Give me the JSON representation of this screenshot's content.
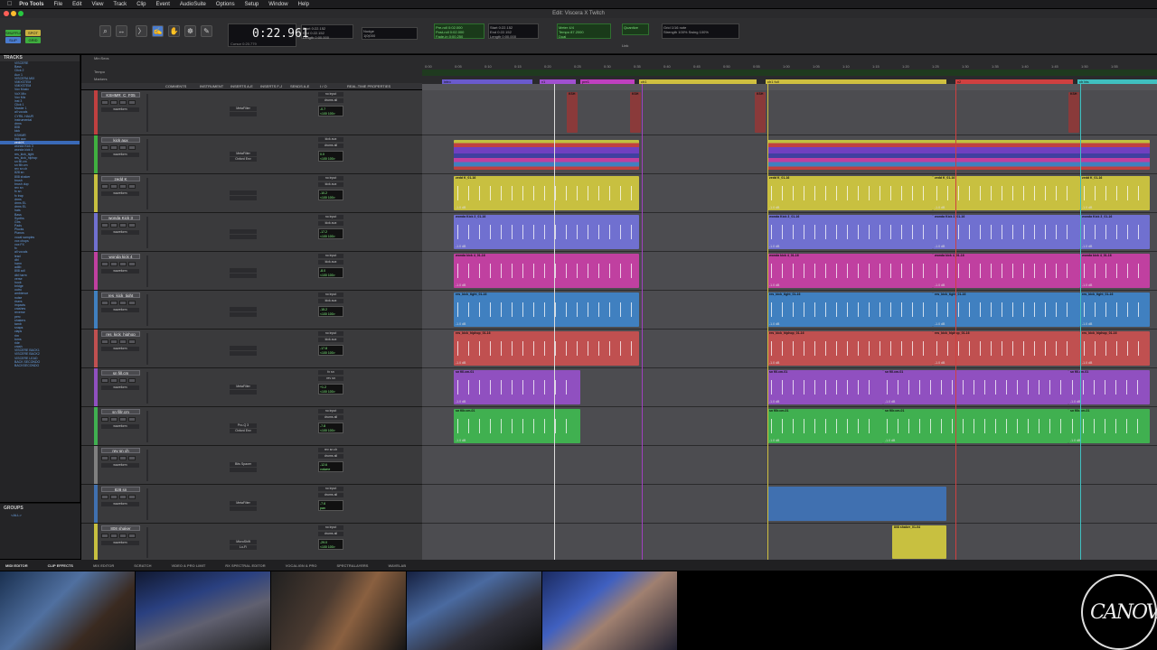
{
  "menubar": {
    "app": "Pro Tools",
    "items": [
      "File",
      "Edit",
      "View",
      "Track",
      "Clip",
      "Event",
      "AudioSuite",
      "Options",
      "Setup",
      "Window",
      "Help"
    ]
  },
  "window": {
    "title": "Edit: Viscera X Twitch"
  },
  "toolbar": {
    "modes": [
      "SHUFFLE",
      "SPOT",
      "SLIP",
      "GRID"
    ],
    "counter_main": "0:22.961",
    "cursor_label": "Cursor",
    "cursor_value": "0:20.779",
    "start_label": "Start",
    "start_value": "0:22.152",
    "end_label": "End",
    "end_value": "0:22.152",
    "length_label": "Length",
    "length_value": "0:00.000",
    "nudge_label": "Nudge",
    "nudge_value": "1|0|000",
    "preroll_label": "Pre-roll",
    "preroll_value": "0:02.000",
    "postroll_label": "Post-roll",
    "postroll_value": "0:02.000",
    "fadein_label": "Fade-in",
    "fadein_value": "0:00.250",
    "start2_value": "0:22.152",
    "end2_value": "0:22.152",
    "length2_value": "0:00.000",
    "meter_label": "Meter",
    "meter_value": "4/4",
    "tempo_label": "Tempo",
    "tempo_value": "87.2000",
    "dual_label": "Dual",
    "grid_label": "Grid",
    "grid_value": "1/16 note",
    "quantize_label": "Quantize",
    "strength_label": "Strength",
    "strength_value": "100%",
    "swing_label": "Swing",
    "swing_value": "100%",
    "link_label": "Link"
  },
  "tracks_panel": {
    "header": "TRACKS",
    "items": [
      "VISCERE",
      "Bass",
      "Click 2",
      "Aux 1",
      "VISCERA MIX",
      "VMIXSTEM",
      "VMIXSTEM",
      "Vox Music",
      "VoX Mix",
      "Vox Mix",
      "inst 3",
      "Click 1",
      "Master 1",
      "all vocals",
      "CYRIL HAUR",
      "instrumental",
      "drms",
      "808",
      "kick",
      "KSHMR",
      "kick aux",
      "zedd K",
      "wonda Kick 3",
      "wonda kick 4",
      "res_kick_tight",
      "res_kick_hiphop",
      "sn fill.cm",
      "sn fillr.cm",
      "rev sn ch",
      "828 sn",
      "808 shaker",
      "brush",
      "brush dup",
      "rev sn",
      "fx sn",
      "fx trap",
      "drms",
      "drms EL",
      "drms EL",
      "hats",
      "Bass",
      "Synths",
      "Gtrs",
      "Pads",
      "Plucks",
      "Pianos",
      "vocal samples",
      "vox chops",
      "vox FX",
      "fx",
      "all vocals",
      "lead",
      "dbl",
      "harm",
      "adlib",
      "808 adl",
      "dbl harm",
      "verse",
      "hook",
      "bridge",
      "outro",
      "ambience",
      "noise",
      "risers",
      "impacts",
      "crashes",
      "reverse",
      "perc",
      "shakers",
      "tamb",
      "snaps",
      "claps",
      "rim",
      "toms",
      "ride",
      "crash",
      "VISCERE BACK1",
      "VISCERE BACK2",
      "VISCERE LEAD",
      "BACK SECONDO",
      "BACKSECONDO"
    ],
    "selected_index": 21
  },
  "groups_panel": {
    "header": "GROUPS",
    "items": [
      "<ALL>"
    ]
  },
  "rulers": {
    "labels": [
      "Min:Secs",
      "Tempo",
      "Markers"
    ],
    "ticks": [
      "0:00",
      "0:05",
      "0:10",
      "0:15",
      "0:20",
      "0:25",
      "0:30",
      "0:35",
      "0:40",
      "0:45",
      "0:50",
      "0:55",
      "1:00",
      "1:05",
      "1:10",
      "1:15",
      "1:20",
      "1:25",
      "1:30",
      "1:35",
      "1:40",
      "1:45",
      "1:50",
      "1:55"
    ]
  },
  "column_headers": [
    "COMMENTS",
    "INSTRUMENT",
    "INSERTS A-E",
    "INSERTS F-J",
    "SENDS A-E",
    "I / O",
    "REAL-TIME PROPERTIES"
  ],
  "markers": [
    {
      "label": "intro",
      "color": "#6a5acd"
    },
    {
      "label": "v1",
      "color": "#a050d0"
    },
    {
      "label": "pre1",
      "color": "#c040c0"
    },
    {
      "label": "ch1",
      "color": "#d0c040"
    },
    {
      "label": "ch1 full",
      "color": "#d0c040"
    },
    {
      "label": "v2",
      "color": "#d04040"
    },
    {
      "label": "ch bis",
      "color": "#40c0c0"
    }
  ],
  "tracks": [
    {
      "name": "KSHMR_C_F05",
      "color": "#c04040",
      "insert": "MetaFilter",
      "io_in": "no input",
      "io_out": "drums all",
      "vol": "-0.7",
      "pan": "<100 100>",
      "clip": "KSH"
    },
    {
      "name": "kick aux",
      "color": "#40b040",
      "insert": "MetaFilter",
      "insert2": "Oxford Env",
      "io_in": "kick aux",
      "io_out": "drums all",
      "vol": "0.0",
      "pan": "<100 100>"
    },
    {
      "name": "zedd K",
      "color": "#c8c040",
      "insert": "",
      "io_in": "no input",
      "io_out": "kick aux",
      "vol": "-10.2",
      "pan": "<100 100>",
      "clip": "zedd K_01-16"
    },
    {
      "name": "wonda Kick 3",
      "color": "#7070d0",
      "insert": "",
      "io_in": "no input",
      "io_out": "kick aux",
      "vol": "-17.2",
      "pan": "<100 100>",
      "clip": "wonda Kick 3_01-16"
    },
    {
      "name": "wonda kick 4",
      "color": "#c040a0",
      "insert": "",
      "io_in": "no input",
      "io_out": "kick aux",
      "vol": "-8.0",
      "pan": "<100 100>",
      "clip": "wonda kick 4_01-16"
    },
    {
      "name": "res_kick_tight",
      "color": "#4080c0",
      "insert": "",
      "io_in": "no input",
      "io_out": "kick aux",
      "vol": "-15.2",
      "pan": "<100 100>",
      "clip": "res_kick_tight_01-16"
    },
    {
      "name": "res_kick_hiphop",
      "color": "#c05050",
      "insert": "",
      "io_in": "no input",
      "io_out": "kick aux",
      "vol": "-17.8",
      "pan": "<100 100>",
      "clip": "res_kick_hiphop_01-16"
    },
    {
      "name": "sn fill.cm",
      "color": "#9050c0",
      "insert": "MetaFilter",
      "io_in": "fx sn",
      "io_out": "rev sn",
      "vol": "+1.2",
      "pan": "<100 100>",
      "clip": "sn fill.cm-01"
    },
    {
      "name": "sn fillr.cm",
      "color": "#40b050",
      "insert": "Pro-Q 3",
      "insert2": "Oxford Env",
      "io_in": "no input",
      "io_out": "drums all",
      "vol": "-7.8",
      "pan": "<100 100>",
      "clip": "sn fillr.cm-01"
    },
    {
      "name": "rev sn ch",
      "color": "#808080",
      "insert": "Bits Spacer",
      "io_in": "rev sn ch",
      "io_out": "drums all",
      "vol": "-12.6",
      "pan": "volume"
    },
    {
      "name": "828 sn",
      "color": "#4070b0",
      "insert": "MetaFilter",
      "io_in": "no input",
      "io_out": "drums all",
      "vol": "-7.6",
      "pan": "pan"
    },
    {
      "name": "808 shaker",
      "color": "#c8c040",
      "insert": "MicroShift",
      "insert2": "Lo-Fi",
      "io_in": "no input",
      "io_out": "drums all",
      "vol": "-29.0",
      "pan": "<100 100>",
      "clip": "808 shaker_01-04"
    }
  ],
  "bottom_tabs": [
    "MIDI EDITOR",
    "CLIP EFFECTS",
    "MIX EDITOR",
    "SCRATCH",
    "VIDEO & PRO LIMIT",
    "RX SPECTRAL EDITOR",
    "VOCALIGN & PRO",
    "SPECTRALAYERS",
    "WAVELAB"
  ],
  "db_label": "-1.0 dB",
  "logo_text": "CANOVA"
}
